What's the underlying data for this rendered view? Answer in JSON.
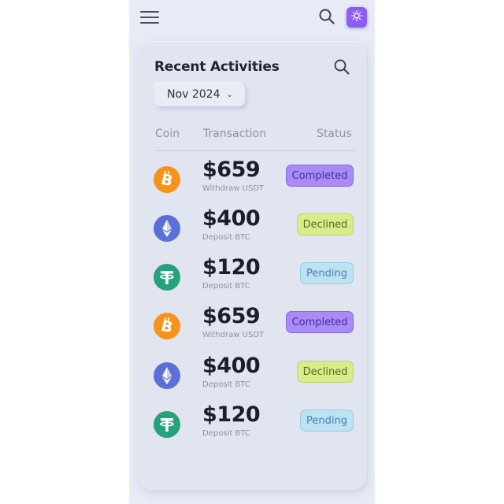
{
  "header": {
    "menu_icon": "hamburger-menu-icon",
    "search_icon": "search-icon",
    "theme_icon": "sun-icon"
  },
  "card": {
    "title": "Recent Activities",
    "search_icon": "search-icon",
    "month_filter": "Nov 2024",
    "month_chevron_icon": "chevron-down-icon",
    "columns": {
      "coin": "Coin",
      "transaction": "Transaction",
      "status": "Status"
    }
  },
  "transactions": [
    {
      "coin": "bitcoin",
      "amount": "$659",
      "description": "Withdraw USDT",
      "status": "Completed"
    },
    {
      "coin": "ethereum",
      "amount": "$400",
      "description": "Deposit BTC",
      "status": "Declined"
    },
    {
      "coin": "tether",
      "amount": "$120",
      "description": "Deposit BTC",
      "status": "Pending"
    },
    {
      "coin": "bitcoin",
      "amount": "$659",
      "description": "Withdraw USDT",
      "status": "Completed"
    },
    {
      "coin": "ethereum",
      "amount": "$400",
      "description": "Deposit BTC",
      "status": "Declined"
    },
    {
      "coin": "tether",
      "amount": "$120",
      "description": "Deposit BTC",
      "status": "Pending"
    }
  ],
  "colors": {
    "background": "#e7ebf6",
    "card": "#e1e5f0",
    "accent": "#8b5cf6",
    "bitcoin": "#f7931a",
    "ethereum": "#5b6fd8",
    "tether": "#26a17b",
    "completed": "#a98bf5",
    "declined": "#d7ec8a",
    "pending": "#bfe2f3"
  }
}
